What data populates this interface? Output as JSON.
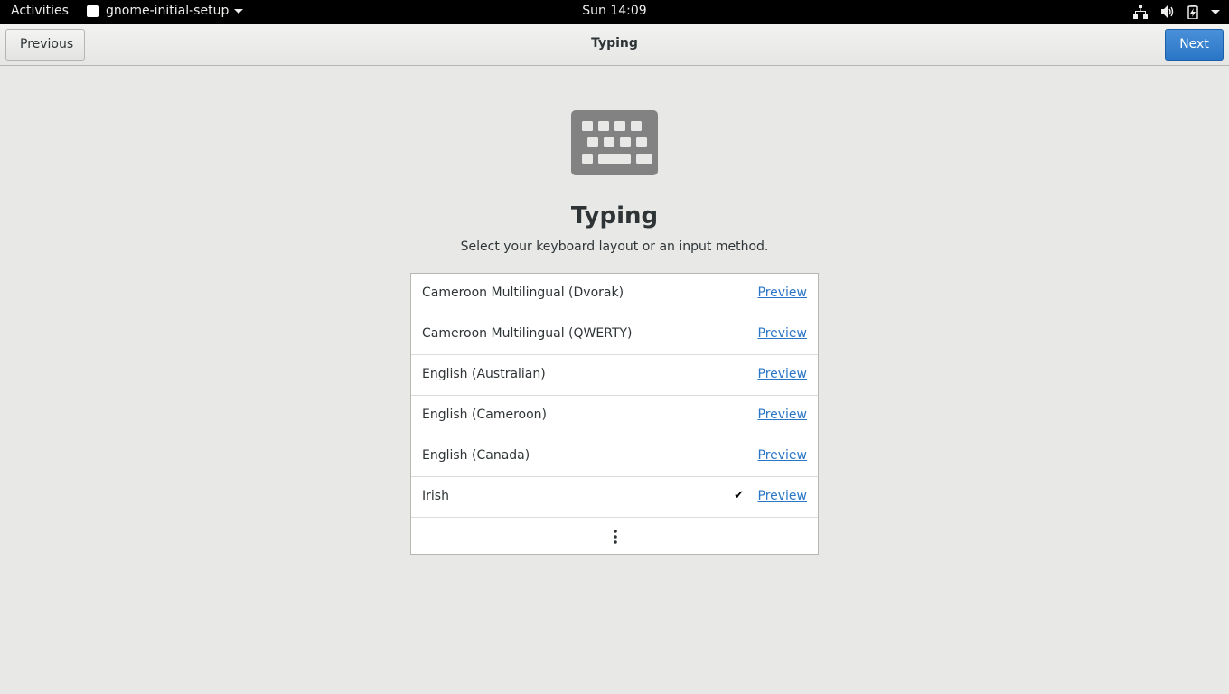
{
  "topbar": {
    "activities": "Activities",
    "app_name": "gnome-initial-setup",
    "clock": "Sun 14:09",
    "status_icons": [
      "network-icon",
      "volume-icon",
      "battery-icon",
      "system-menu-arrow-icon"
    ]
  },
  "headerbar": {
    "previous_label": "Previous",
    "title": "Typing",
    "next_label": "Next"
  },
  "page": {
    "icon": "keyboard-icon",
    "heading": "Typing",
    "subheading": "Select your keyboard layout or an input method."
  },
  "layouts": [
    {
      "name": "Cameroon Multilingual (Dvorak)",
      "preview": "Preview",
      "selected": false
    },
    {
      "name": "Cameroon Multilingual (QWERTY)",
      "preview": "Preview",
      "selected": false
    },
    {
      "name": "English (Australian)",
      "preview": "Preview",
      "selected": false
    },
    {
      "name": "English (Cameroon)",
      "preview": "Preview",
      "selected": false
    },
    {
      "name": "English (Canada)",
      "preview": "Preview",
      "selected": false
    },
    {
      "name": "Irish",
      "preview": "Preview",
      "selected": true
    }
  ],
  "check_glyph": "✔",
  "colors": {
    "accent": "#2a76c6",
    "background": "#e8e8e7",
    "topbar": "#000000"
  }
}
